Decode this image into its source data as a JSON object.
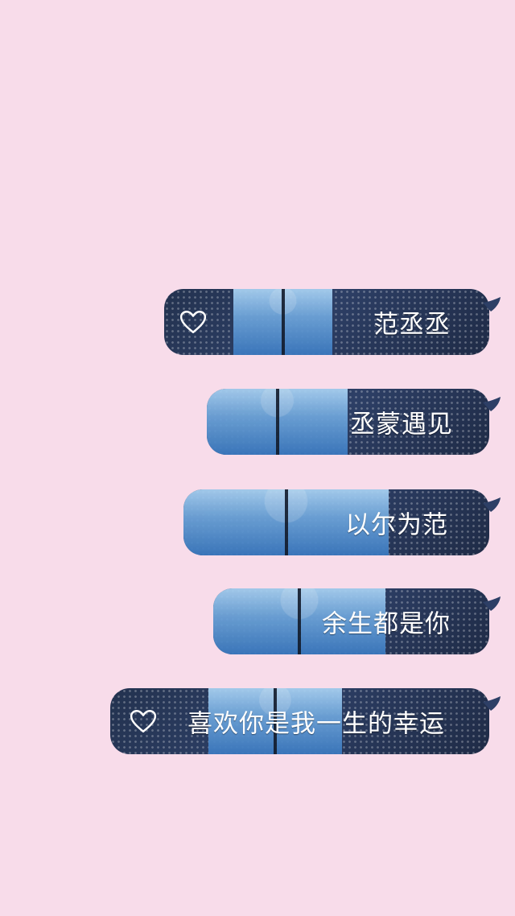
{
  "colors": {
    "page_background": "#f8dcea",
    "bubble_dark": "#2d3f66",
    "photo_blue": "#6da3d8",
    "text": "#ffffff"
  },
  "messages": [
    {
      "text": "范丞丞",
      "icon": "heart-icon"
    },
    {
      "text": "丞蒙遇见"
    },
    {
      "text": "以尔为范"
    },
    {
      "text": "余生都是你"
    },
    {
      "text": "喜欢你是我一生的幸运",
      "icon": "heart-icon"
    }
  ]
}
